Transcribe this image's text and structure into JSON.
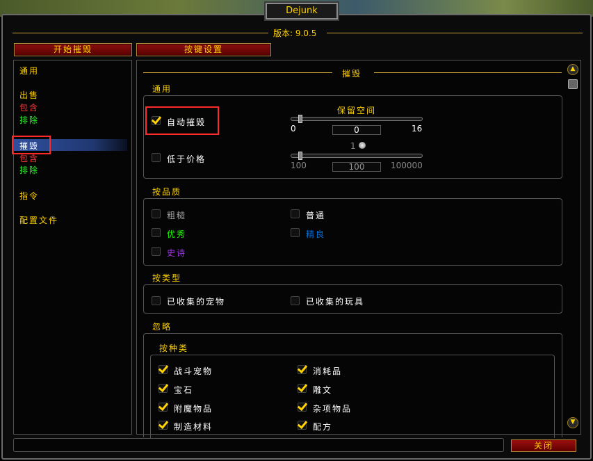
{
  "window": {
    "title": "Dejunk",
    "version": "版本: 9.0.5"
  },
  "tabs": {
    "start_destroy": "开始摧毁",
    "keybind": "按键设置"
  },
  "sidebar": {
    "general": "通用",
    "sell": "出售",
    "sell_include": "包含",
    "sell_exclude": "排除",
    "destroy": "摧毁",
    "destroy_include": "包含",
    "destroy_exclude": "排除",
    "commands": "指令",
    "profiles": "配置文件"
  },
  "main": {
    "title": "摧毁",
    "general": {
      "heading": "通用",
      "auto_destroy": {
        "label": "自动摧毁",
        "checked": true
      },
      "below_price": {
        "label": "低于价格",
        "checked": false
      },
      "reserve_space": {
        "label": "保留空间",
        "min": "0",
        "max": "16",
        "value": "0",
        "level": 0
      },
      "price": {
        "coin": "1",
        "min": "100",
        "max": "100000",
        "value": "100",
        "level": 0
      }
    },
    "by_quality": {
      "heading": "按品质",
      "items": [
        {
          "label": "粗糙",
          "checked": false,
          "color": "#9d9d9d"
        },
        {
          "label": "普通",
          "checked": false,
          "color": "#ffffff"
        },
        {
          "label": "优秀",
          "checked": false,
          "color": "#1eff00"
        },
        {
          "label": "精良",
          "checked": false,
          "color": "#0070dd"
        },
        {
          "label": "史诗",
          "checked": false,
          "color": "#a335ee"
        }
      ]
    },
    "by_type": {
      "heading": "按类型",
      "items": [
        {
          "label": "已收集的宠物",
          "checked": false
        },
        {
          "label": "已收集的玩具",
          "checked": false
        }
      ]
    },
    "ignore": {
      "heading": "忽略",
      "by_class": {
        "heading": "按种类",
        "items": [
          {
            "label": "战斗宠物",
            "checked": true
          },
          {
            "label": "消耗品",
            "checked": true
          },
          {
            "label": "宝石",
            "checked": true
          },
          {
            "label": "雕文",
            "checked": true
          },
          {
            "label": "附魔物品",
            "checked": true
          },
          {
            "label": "杂项物品",
            "checked": true
          },
          {
            "label": "制造材料",
            "checked": true
          },
          {
            "label": "配方",
            "checked": true
          }
        ]
      }
    }
  },
  "footer": {
    "close": "关闭"
  },
  "colors": {
    "gold": "#ffd200",
    "red": "#ff3a3a",
    "green": "#20ff20",
    "button_red": "#8a1010"
  }
}
